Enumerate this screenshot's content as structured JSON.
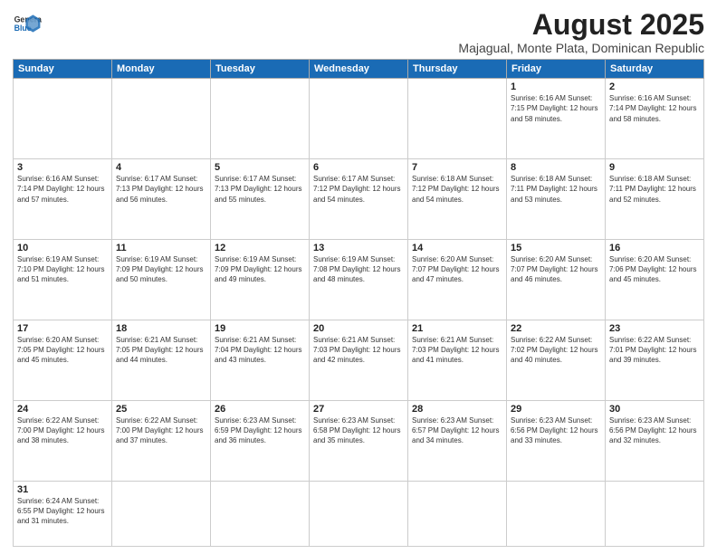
{
  "header": {
    "logo_general": "General",
    "logo_blue": "Blue",
    "title": "August 2025",
    "subtitle": "Majagual, Monte Plata, Dominican Republic"
  },
  "weekdays": [
    "Sunday",
    "Monday",
    "Tuesday",
    "Wednesday",
    "Thursday",
    "Friday",
    "Saturday"
  ],
  "weeks": [
    [
      {
        "day": "",
        "info": ""
      },
      {
        "day": "",
        "info": ""
      },
      {
        "day": "",
        "info": ""
      },
      {
        "day": "",
        "info": ""
      },
      {
        "day": "",
        "info": ""
      },
      {
        "day": "1",
        "info": "Sunrise: 6:16 AM\nSunset: 7:15 PM\nDaylight: 12 hours\nand 58 minutes."
      },
      {
        "day": "2",
        "info": "Sunrise: 6:16 AM\nSunset: 7:14 PM\nDaylight: 12 hours\nand 58 minutes."
      }
    ],
    [
      {
        "day": "3",
        "info": "Sunrise: 6:16 AM\nSunset: 7:14 PM\nDaylight: 12 hours\nand 57 minutes."
      },
      {
        "day": "4",
        "info": "Sunrise: 6:17 AM\nSunset: 7:13 PM\nDaylight: 12 hours\nand 56 minutes."
      },
      {
        "day": "5",
        "info": "Sunrise: 6:17 AM\nSunset: 7:13 PM\nDaylight: 12 hours\nand 55 minutes."
      },
      {
        "day": "6",
        "info": "Sunrise: 6:17 AM\nSunset: 7:12 PM\nDaylight: 12 hours\nand 54 minutes."
      },
      {
        "day": "7",
        "info": "Sunrise: 6:18 AM\nSunset: 7:12 PM\nDaylight: 12 hours\nand 54 minutes."
      },
      {
        "day": "8",
        "info": "Sunrise: 6:18 AM\nSunset: 7:11 PM\nDaylight: 12 hours\nand 53 minutes."
      },
      {
        "day": "9",
        "info": "Sunrise: 6:18 AM\nSunset: 7:11 PM\nDaylight: 12 hours\nand 52 minutes."
      }
    ],
    [
      {
        "day": "10",
        "info": "Sunrise: 6:19 AM\nSunset: 7:10 PM\nDaylight: 12 hours\nand 51 minutes."
      },
      {
        "day": "11",
        "info": "Sunrise: 6:19 AM\nSunset: 7:09 PM\nDaylight: 12 hours\nand 50 minutes."
      },
      {
        "day": "12",
        "info": "Sunrise: 6:19 AM\nSunset: 7:09 PM\nDaylight: 12 hours\nand 49 minutes."
      },
      {
        "day": "13",
        "info": "Sunrise: 6:19 AM\nSunset: 7:08 PM\nDaylight: 12 hours\nand 48 minutes."
      },
      {
        "day": "14",
        "info": "Sunrise: 6:20 AM\nSunset: 7:07 PM\nDaylight: 12 hours\nand 47 minutes."
      },
      {
        "day": "15",
        "info": "Sunrise: 6:20 AM\nSunset: 7:07 PM\nDaylight: 12 hours\nand 46 minutes."
      },
      {
        "day": "16",
        "info": "Sunrise: 6:20 AM\nSunset: 7:06 PM\nDaylight: 12 hours\nand 45 minutes."
      }
    ],
    [
      {
        "day": "17",
        "info": "Sunrise: 6:20 AM\nSunset: 7:05 PM\nDaylight: 12 hours\nand 45 minutes."
      },
      {
        "day": "18",
        "info": "Sunrise: 6:21 AM\nSunset: 7:05 PM\nDaylight: 12 hours\nand 44 minutes."
      },
      {
        "day": "19",
        "info": "Sunrise: 6:21 AM\nSunset: 7:04 PM\nDaylight: 12 hours\nand 43 minutes."
      },
      {
        "day": "20",
        "info": "Sunrise: 6:21 AM\nSunset: 7:03 PM\nDaylight: 12 hours\nand 42 minutes."
      },
      {
        "day": "21",
        "info": "Sunrise: 6:21 AM\nSunset: 7:03 PM\nDaylight: 12 hours\nand 41 minutes."
      },
      {
        "day": "22",
        "info": "Sunrise: 6:22 AM\nSunset: 7:02 PM\nDaylight: 12 hours\nand 40 minutes."
      },
      {
        "day": "23",
        "info": "Sunrise: 6:22 AM\nSunset: 7:01 PM\nDaylight: 12 hours\nand 39 minutes."
      }
    ],
    [
      {
        "day": "24",
        "info": "Sunrise: 6:22 AM\nSunset: 7:00 PM\nDaylight: 12 hours\nand 38 minutes."
      },
      {
        "day": "25",
        "info": "Sunrise: 6:22 AM\nSunset: 7:00 PM\nDaylight: 12 hours\nand 37 minutes."
      },
      {
        "day": "26",
        "info": "Sunrise: 6:23 AM\nSunset: 6:59 PM\nDaylight: 12 hours\nand 36 minutes."
      },
      {
        "day": "27",
        "info": "Sunrise: 6:23 AM\nSunset: 6:58 PM\nDaylight: 12 hours\nand 35 minutes."
      },
      {
        "day": "28",
        "info": "Sunrise: 6:23 AM\nSunset: 6:57 PM\nDaylight: 12 hours\nand 34 minutes."
      },
      {
        "day": "29",
        "info": "Sunrise: 6:23 AM\nSunset: 6:56 PM\nDaylight: 12 hours\nand 33 minutes."
      },
      {
        "day": "30",
        "info": "Sunrise: 6:23 AM\nSunset: 6:56 PM\nDaylight: 12 hours\nand 32 minutes."
      }
    ],
    [
      {
        "day": "31",
        "info": "Sunrise: 6:24 AM\nSunset: 6:55 PM\nDaylight: 12 hours\nand 31 minutes."
      },
      {
        "day": "",
        "info": ""
      },
      {
        "day": "",
        "info": ""
      },
      {
        "day": "",
        "info": ""
      },
      {
        "day": "",
        "info": ""
      },
      {
        "day": "",
        "info": ""
      },
      {
        "day": "",
        "info": ""
      }
    ]
  ]
}
